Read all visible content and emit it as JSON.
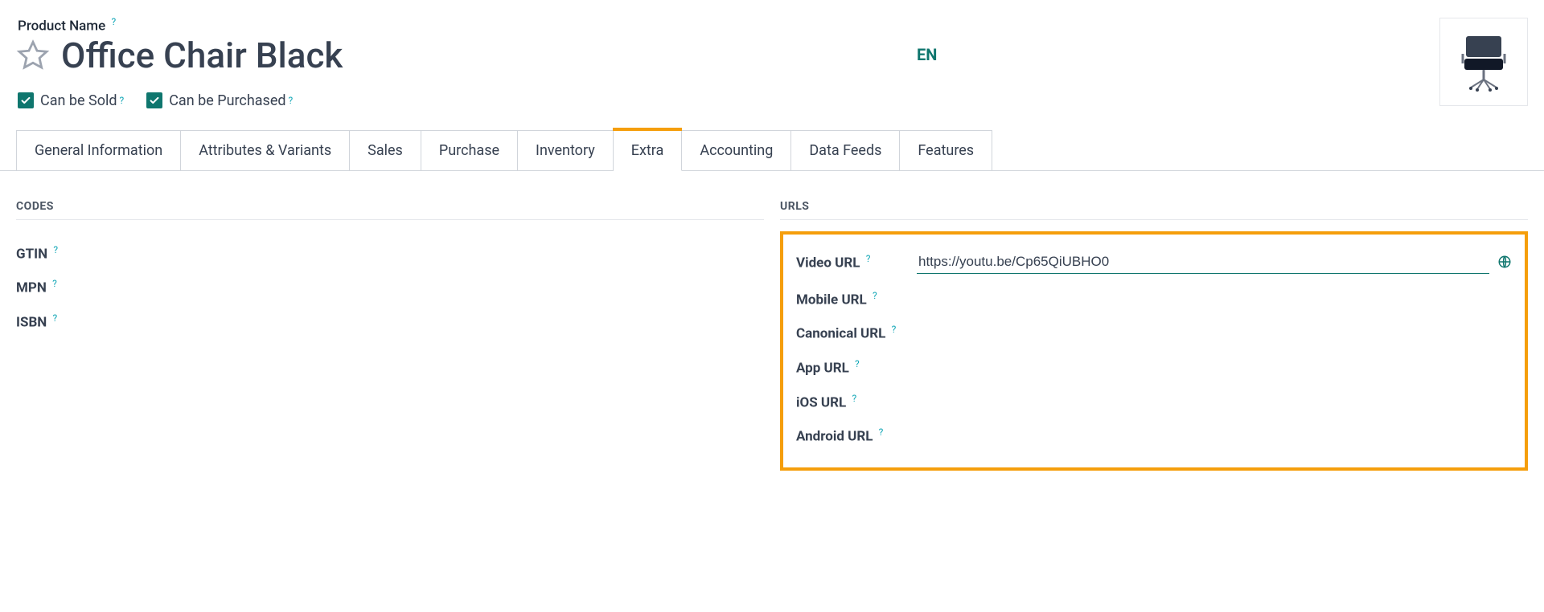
{
  "header": {
    "product_name_label": "Product Name",
    "product_title": "Office Chair Black",
    "lang": "EN",
    "can_be_sold_label": "Can be Sold",
    "can_be_purchased_label": "Can be Purchased"
  },
  "tabs": {
    "general": "General Information",
    "attributes": "Attributes & Variants",
    "sales": "Sales",
    "purchase": "Purchase",
    "inventory": "Inventory",
    "extra": "Extra",
    "accounting": "Accounting",
    "data_feeds": "Data Feeds",
    "features": "Features"
  },
  "sections": {
    "codes_title": "CODES",
    "urls_title": "URLS"
  },
  "codes": {
    "gtin_label": "GTIN",
    "mpn_label": "MPN",
    "isbn_label": "ISBN"
  },
  "urls": {
    "video_label": "Video URL",
    "video_value": "https://youtu.be/Cp65QiUBHO0",
    "mobile_label": "Mobile URL",
    "canonical_label": "Canonical URL",
    "app_label": "App URL",
    "ios_label": "iOS URL",
    "android_label": "Android URL"
  },
  "help_glyph": "?"
}
